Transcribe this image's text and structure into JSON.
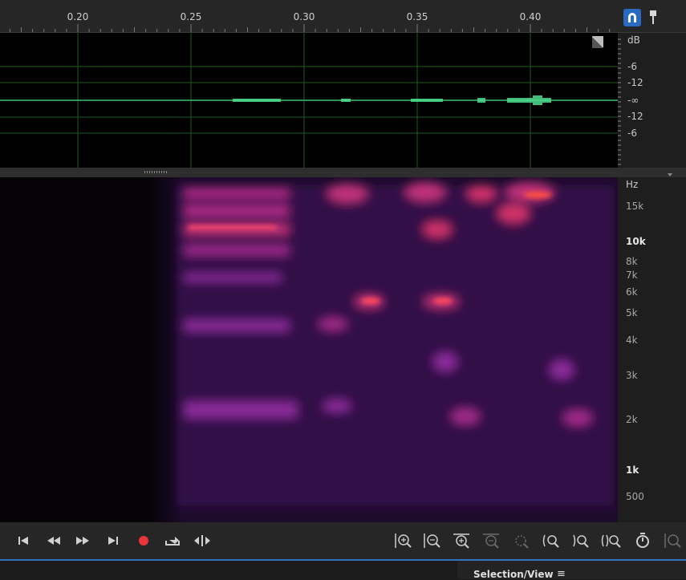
{
  "ruler": {
    "labels": [
      "0.20",
      "0.25",
      "0.30",
      "0.35",
      "0.40"
    ]
  },
  "toolbar_right": {
    "snap_icon": "magnet-icon",
    "pin_icon": "pin-icon"
  },
  "db_scale": {
    "unit": "dB",
    "labels": [
      "-6",
      "-12",
      "-∞",
      "-12",
      "-6"
    ]
  },
  "hz_scale": {
    "unit": "Hz",
    "labels": [
      "15k",
      "10k",
      "8k",
      "7k",
      "6k",
      "5k",
      "4k",
      "3k",
      "2k",
      "1k",
      "500"
    ]
  },
  "transport": {
    "buttons": [
      "skip-to-start-icon",
      "rewind-icon",
      "fast-forward-icon",
      "skip-to-end-icon",
      "record-icon",
      "loop-icon",
      "skip-selection-icon"
    ],
    "zoom_buttons": [
      "zoom-in-amplitude-icon",
      "zoom-out-amplitude-icon",
      "zoom-in-time-icon",
      "zoom-out-time-icon",
      "zoom-selection-icon",
      "zoom-in-left-icon",
      "zoom-in-right-icon",
      "zoom-out-full-icon",
      "zoom-reset-icon",
      "zoom-in-frequency-icon"
    ],
    "record_color": "#e8343a",
    "accent": "#2f74c0"
  },
  "panel": {
    "selection_view_title": "Selection/View",
    "menu_glyph": "≡"
  }
}
